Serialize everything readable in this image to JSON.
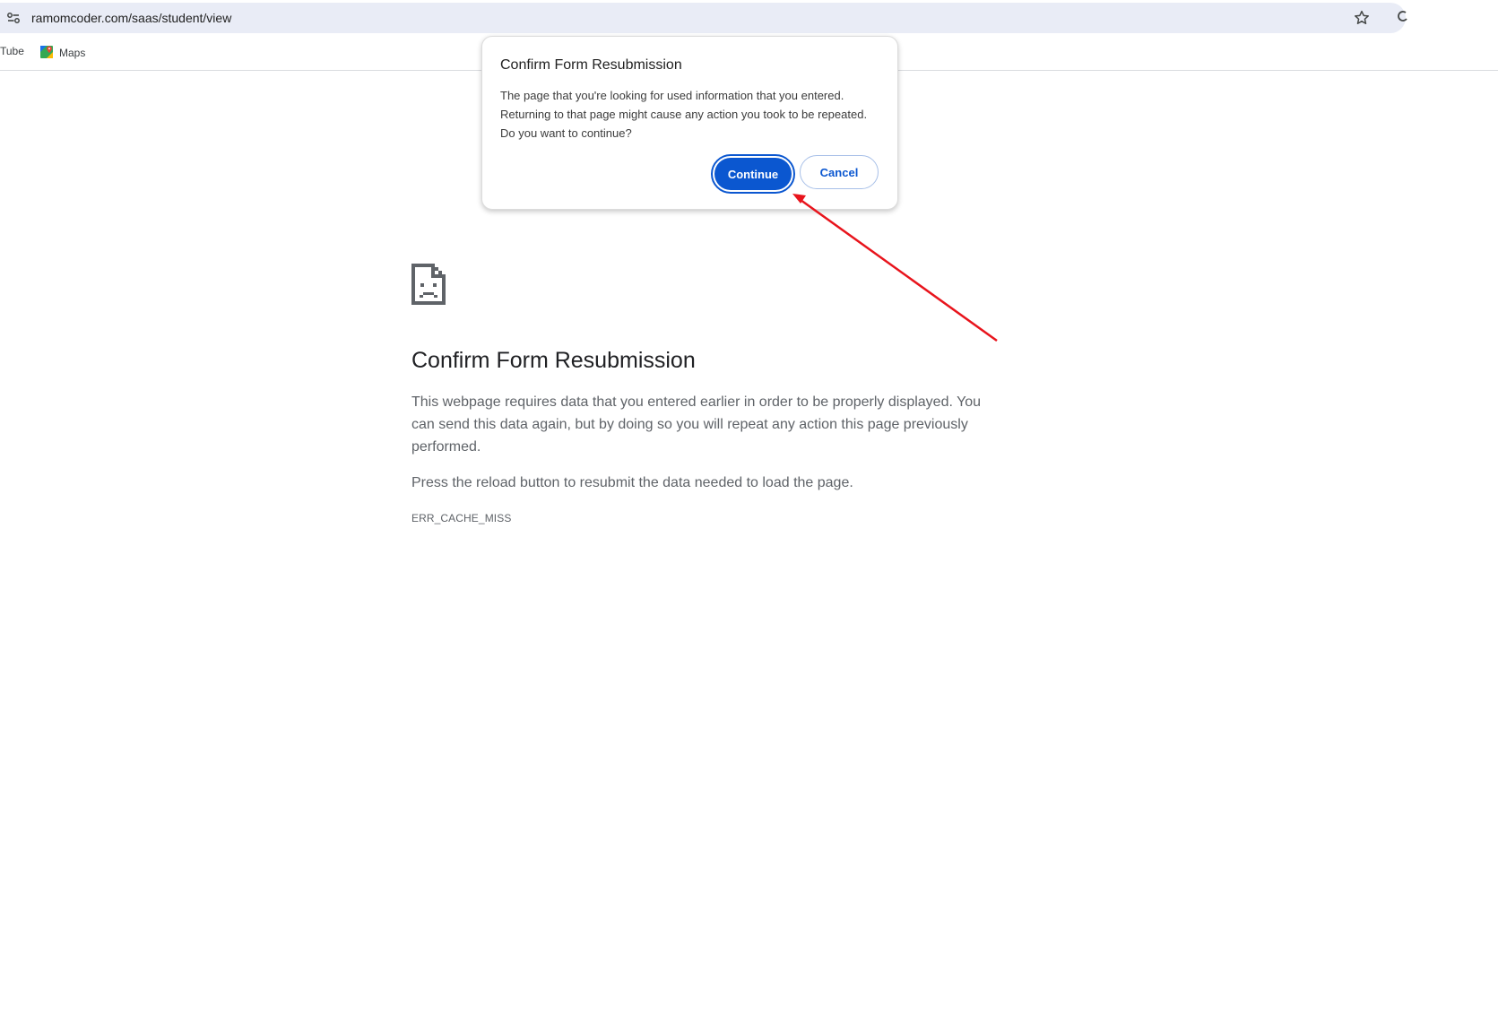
{
  "browser": {
    "url": "ramomcoder.com/saas/student/view",
    "bookmarks": [
      {
        "label": "Tube",
        "icon": "youtube-icon"
      },
      {
        "label": "Maps",
        "icon": "google-maps-icon"
      }
    ]
  },
  "error_page": {
    "icon": "sad-document-icon",
    "title": "Confirm Form Resubmission",
    "description": "This webpage requires data that you entered earlier in order to be properly displayed. You can send this data again, but by doing so you will repeat any action this page previously performed.",
    "hint": "Press the reload button to resubmit the data needed to load the page.",
    "error_code": "ERR_CACHE_MISS"
  },
  "dialog": {
    "title": "Confirm Form Resubmission",
    "message": "The page that you're looking for used information that you entered. Returning to that page might cause any action you took to be repeated. Do you want to continue?",
    "continue_label": "Continue",
    "cancel_label": "Cancel"
  },
  "colors": {
    "accent": "#0b57d0",
    "annotation_arrow": "#e8141c",
    "omnibox_bg": "#e9ecf6"
  }
}
